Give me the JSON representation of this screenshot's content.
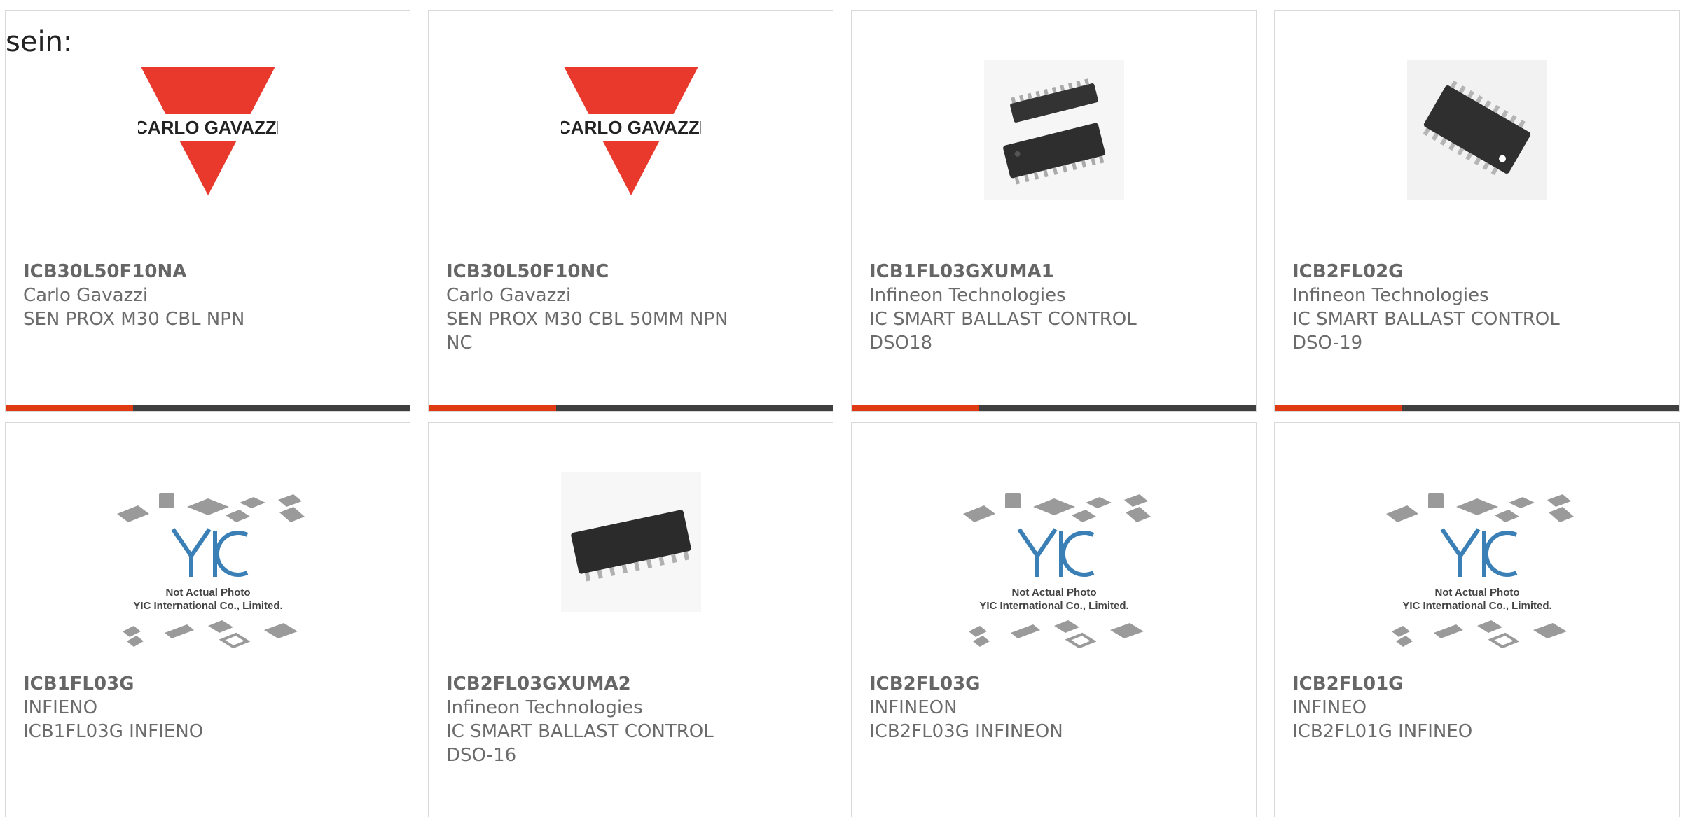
{
  "intro_text": "sein:",
  "accent_color": "#e03a12",
  "bar_color": "#3f3f3f",
  "products": [
    {
      "part_number": "ICB30L50F10NA",
      "manufacturer": "Carlo Gavazzi",
      "description": "SEN PROX M30 CBL NPN",
      "image": "carlo-gavazzi-logo",
      "logo_text": "CARLO GAVAZZI"
    },
    {
      "part_number": "ICB30L50F10NC",
      "manufacturer": "Carlo Gavazzi",
      "description": "SEN PROX M30 CBL 50MM NPN NC",
      "image": "carlo-gavazzi-logo",
      "logo_text": "CARLO GAVAZZI"
    },
    {
      "part_number": "ICB1FL03GXUMA1",
      "manufacturer": "Infineon Technologies",
      "description": "IC SMART BALLAST CONTROL DSO18",
      "image": "ic-chip-photo"
    },
    {
      "part_number": "ICB2FL02G",
      "manufacturer": "Infineon Technologies",
      "description": "IC SMART BALLAST CONTROL DSO-19",
      "image": "ic-chip-photo"
    },
    {
      "part_number": "ICB1FL03G",
      "manufacturer": "INFIENO",
      "description": "ICB1FL03G INFIENO",
      "image": "yic-placeholder",
      "placeholder_line1": "Not Actual Photo",
      "placeholder_line2": "YIC International Co., Limited."
    },
    {
      "part_number": "ICB2FL03GXUMA2",
      "manufacturer": "Infineon Technologies",
      "description": "IC SMART BALLAST CONTROL DSO-16",
      "image": "ic-chip-photo"
    },
    {
      "part_number": "ICB2FL03G",
      "manufacturer": "INFINEON",
      "description": "ICB2FL03G INFINEON",
      "image": "yic-placeholder",
      "placeholder_line1": "Not Actual Photo",
      "placeholder_line2": "YIC International Co., Limited."
    },
    {
      "part_number": "ICB2FL01G",
      "manufacturer": "INFINEO",
      "description": "ICB2FL01G INFINEO",
      "image": "yic-placeholder",
      "placeholder_line1": "Not Actual Photo",
      "placeholder_line2": "YIC International Co., Limited."
    }
  ]
}
